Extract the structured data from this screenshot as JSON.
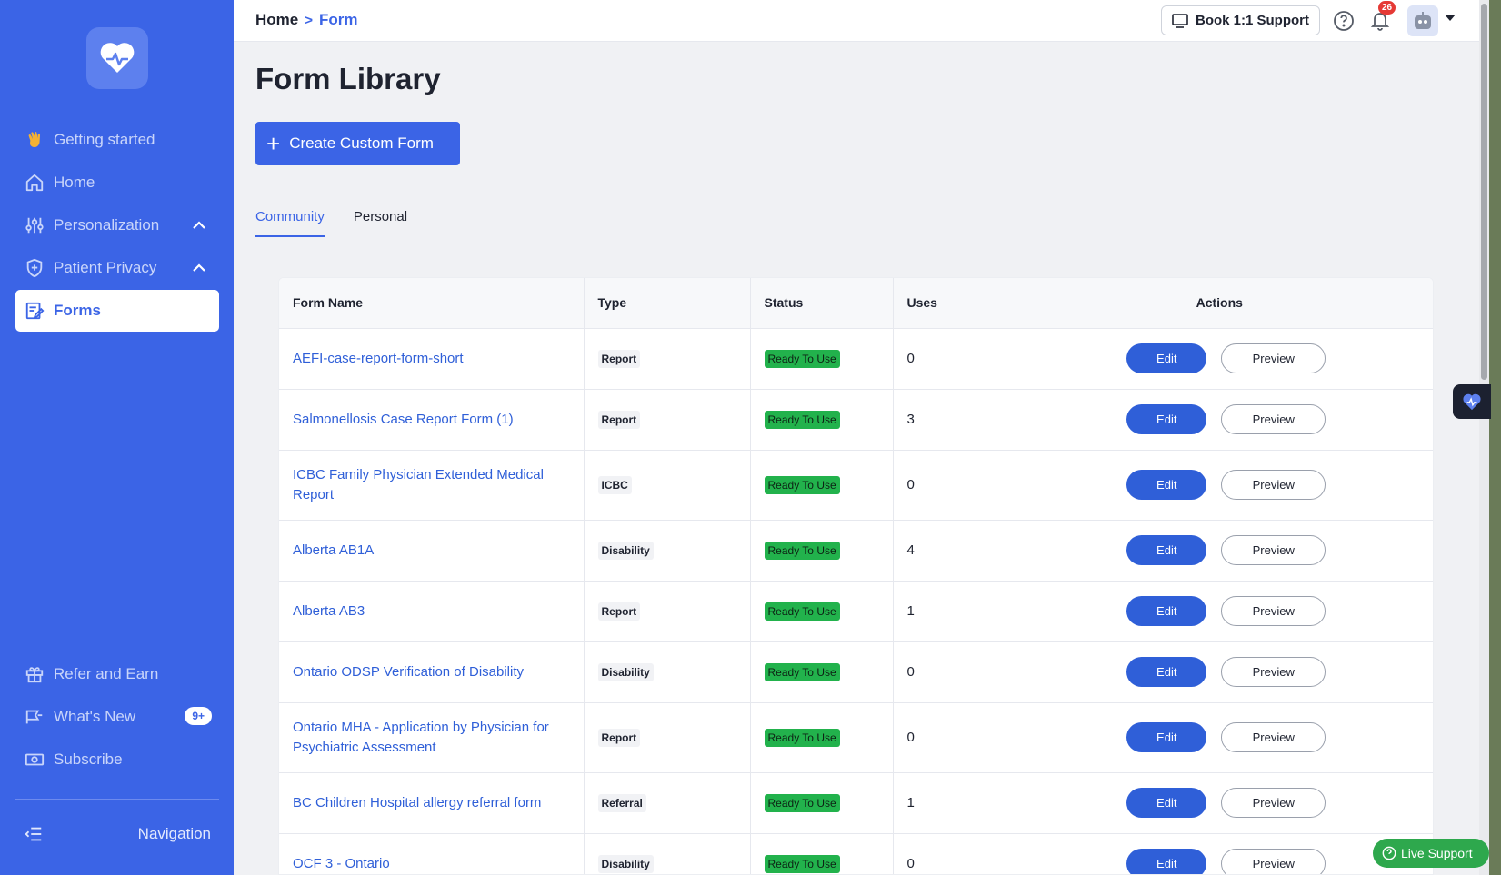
{
  "sidebar": {
    "items": [
      {
        "label": "Getting started"
      },
      {
        "label": "Home"
      },
      {
        "label": "Personalization"
      },
      {
        "label": "Patient Privacy"
      },
      {
        "label": "Forms"
      }
    ],
    "bottom_items": [
      {
        "label": "Refer and Earn"
      },
      {
        "label": "What's New",
        "badge": "9+"
      },
      {
        "label": "Subscribe"
      }
    ],
    "footer_label": "Navigation"
  },
  "topbar": {
    "breadcrumb": {
      "home": "Home",
      "sep": ">",
      "current": "Form"
    },
    "support_label": "Book 1:1 Support",
    "notifications_count": "26"
  },
  "page": {
    "title": "Form Library",
    "create_label": "Create Custom Form",
    "create_plus": "+",
    "tabs": [
      {
        "label": "Community",
        "active": true
      },
      {
        "label": "Personal",
        "active": false
      }
    ]
  },
  "table": {
    "headers": [
      "Form Name",
      "Type",
      "Status",
      "Uses",
      "Actions"
    ],
    "edit_label": "Edit",
    "preview_label": "Preview",
    "rows": [
      {
        "name": "AEFI-case-report-form-short",
        "type": "Report",
        "status": "Ready To Use",
        "uses": "0"
      },
      {
        "name": "Salmonellosis Case Report Form (1)",
        "type": "Report",
        "status": "Ready To Use",
        "uses": "3"
      },
      {
        "name": "ICBC Family Physician Extended Medical Report",
        "type": "ICBC",
        "status": "Ready To Use",
        "uses": "0"
      },
      {
        "name": "Alberta AB1A",
        "type": "Disability",
        "status": "Ready To Use",
        "uses": "4"
      },
      {
        "name": "Alberta AB3",
        "type": "Report",
        "status": "Ready To Use",
        "uses": "1"
      },
      {
        "name": "Ontario ODSP Verification of Disability",
        "type": "Disability",
        "status": "Ready To Use",
        "uses": "0"
      },
      {
        "name": "Ontario MHA - Application by Physician for Psychiatric Assessment",
        "type": "Report",
        "status": "Ready To Use",
        "uses": "0"
      },
      {
        "name": "BC Children Hospital allergy referral form",
        "type": "Referral",
        "status": "Ready To Use",
        "uses": "1"
      },
      {
        "name": "OCF 3 - Ontario",
        "type": "Disability",
        "status": "Ready To Use",
        "uses": "0"
      }
    ]
  },
  "live_support_label": "Live Support",
  "colors": {
    "brand": "#3b64e6",
    "status_green": "#22b24c",
    "live_support": "#2ea84d",
    "badge_red": "#e53935"
  }
}
